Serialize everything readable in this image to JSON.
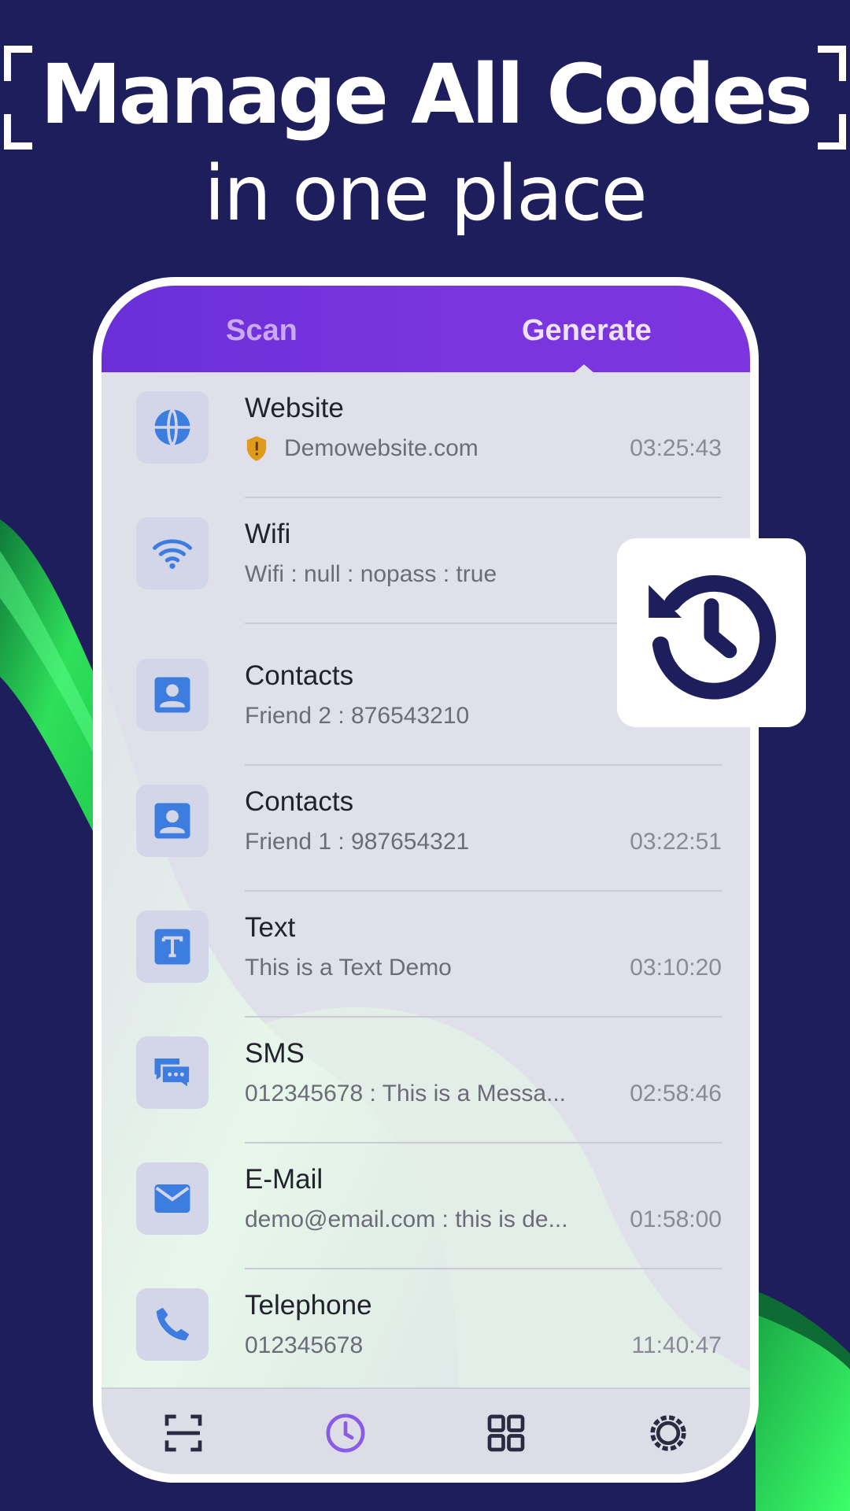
{
  "headline": {
    "title": "Manage All Codes",
    "subtitle": "in one place"
  },
  "tabs": [
    {
      "label": "Scan",
      "active": false
    },
    {
      "label": "Generate",
      "active": true
    }
  ],
  "history": [
    {
      "type": "Website",
      "icon": "globe-icon",
      "value": "Demowebsite.com",
      "time": "03:25:43",
      "badge": "shield-warning-icon"
    },
    {
      "type": "Wifi",
      "icon": "wifi-icon",
      "value": "Wifi : null : nopass : true",
      "time": ""
    },
    {
      "type": "Contacts",
      "icon": "contact-icon",
      "value": "Friend 2 : 876543210",
      "time": ""
    },
    {
      "type": "Contacts",
      "icon": "contact-icon",
      "value": "Friend 1 : 987654321",
      "time": "03:22:51"
    },
    {
      "type": "Text",
      "icon": "text-icon",
      "value": "This is a Text Demo",
      "time": "03:10:20"
    },
    {
      "type": "SMS",
      "icon": "sms-icon",
      "value": "012345678 : This is a Messa...",
      "time": "02:58:46"
    },
    {
      "type": "E-Mail",
      "icon": "email-icon",
      "value": "demo@email.com : this is de...",
      "time": "01:58:00"
    },
    {
      "type": "Telephone",
      "icon": "phone-icon",
      "value": "012345678",
      "time": "11:40:47"
    }
  ],
  "bottom_nav": [
    {
      "icon": "scan-icon",
      "active": false
    },
    {
      "icon": "history-icon",
      "active": true
    },
    {
      "icon": "grid-icon",
      "active": false
    },
    {
      "icon": "settings-icon",
      "active": false
    }
  ],
  "colors": {
    "background": "#1e1e5c",
    "tab_bar": "#7a35de",
    "accent_blue": "#3d7de0",
    "active_nav": "#8a5ce6",
    "icon_dark": "#1e1e5c",
    "green_wave": "#2fe05a"
  }
}
